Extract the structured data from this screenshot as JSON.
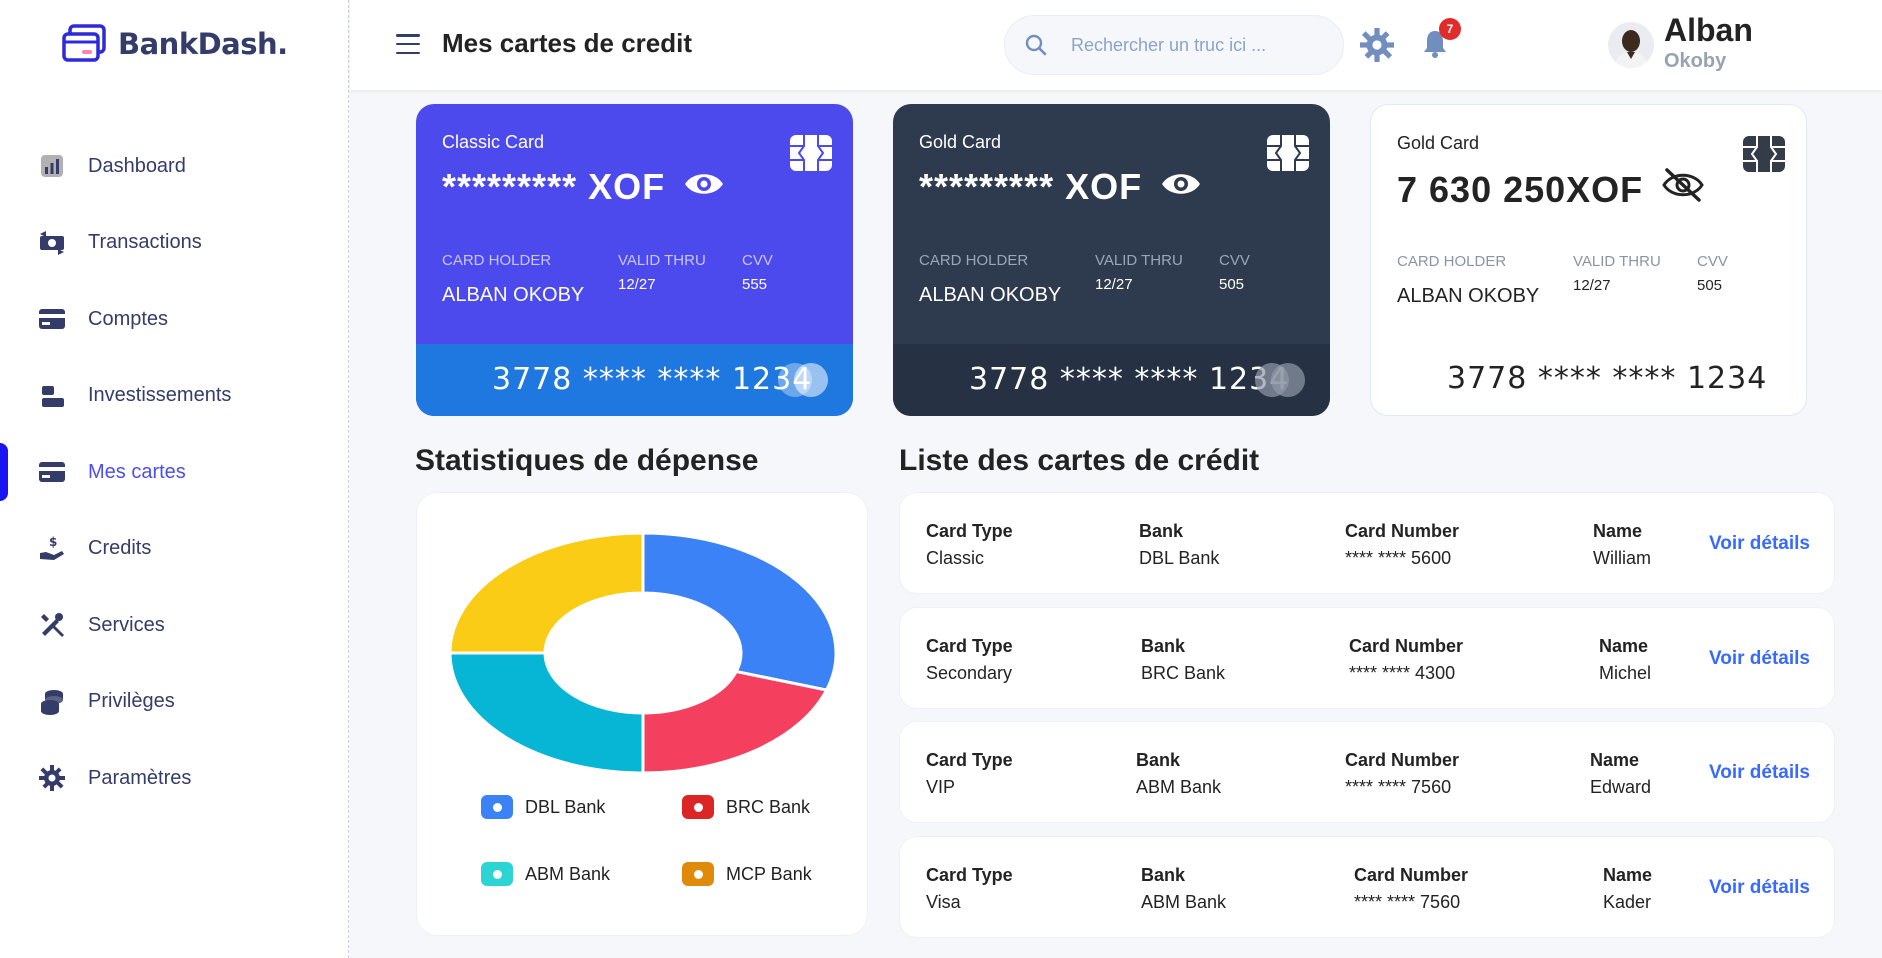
{
  "brand": {
    "name": "BankDash."
  },
  "header": {
    "title": "Mes cartes de credit",
    "search_placeholder": "Rechercher un truc ici ...",
    "notifications_count": "7",
    "user_first": "Alban",
    "user_last": "Okoby"
  },
  "sidebar": {
    "items": [
      {
        "label": "Dashboard",
        "icon": "dashboard-icon"
      },
      {
        "label": "Transactions",
        "icon": "transactions-icon"
      },
      {
        "label": "Comptes",
        "icon": "credit-card-icon"
      },
      {
        "label": "Investissements",
        "icon": "investments-icon"
      },
      {
        "label": "Mes cartes",
        "icon": "credit-card-icon",
        "active": true
      },
      {
        "label": "Credits",
        "icon": "loan-hand-icon"
      },
      {
        "label": "Services",
        "icon": "tools-icon"
      },
      {
        "label": "Privilèges",
        "icon": "coins-icon"
      },
      {
        "label": "Paramètres",
        "icon": "gear-icon"
      }
    ]
  },
  "cards": [
    {
      "type": "Classic Card",
      "amount": "********* XOF",
      "holder_label": "CARD HOLDER",
      "holder": "ALBAN OKOBY",
      "valid_label": "VALID THRU",
      "valid": "12/27",
      "cvv_label": "CVV",
      "cvv": "555",
      "number": "3778 **** **** 1234"
    },
    {
      "type": "Gold Card",
      "amount": "********* XOF",
      "holder_label": "CARD HOLDER",
      "holder": "ALBAN OKOBY",
      "valid_label": "VALID THRU",
      "valid": "12/27",
      "cvv_label": "CVV",
      "cvv": "505",
      "number": "3778 **** **** 1234"
    },
    {
      "type": "Gold Card",
      "amount": "7 630 250XOF",
      "holder_label": "CARD HOLDER",
      "holder": "ALBAN OKOBY",
      "valid_label": "VALID THRU",
      "valid": "12/27",
      "cvv_label": "CVV",
      "cvv": "505",
      "number": "3778 **** **** 1234"
    }
  ],
  "sections": {
    "stats_title": "Statistiques de dépense",
    "list_title": "Liste des cartes de crédit"
  },
  "chart_data": {
    "type": "pie",
    "title": "Statistiques de dépense",
    "categories": [
      "DBL Bank",
      "BRC Bank",
      "ABM Bank",
      "MCP Bank"
    ],
    "values": [
      30,
      20,
      25,
      25
    ],
    "colors": [
      "#3b82f6",
      "#f43f5e",
      "#06b6d4",
      "#facc15"
    ],
    "legend_colors": [
      "#3b82f6",
      "#dc2626",
      "#2dd4d4",
      "#e08a0b"
    ],
    "donut": true
  },
  "credit_list": {
    "headers": {
      "type": "Card Type",
      "bank": "Bank",
      "number": "Card Number",
      "name": "Name"
    },
    "link_label": "Voir détails",
    "rows": [
      {
        "type": "Classic",
        "bank": "DBL Bank",
        "number": "**** **** 5600",
        "name": "William"
      },
      {
        "type": "Secondary",
        "bank": "BRC Bank",
        "number": "**** **** 4300",
        "name": "Michel"
      },
      {
        "type": "VIP",
        "bank": "ABM Bank",
        "number": "**** **** 7560",
        "name": "Edward"
      },
      {
        "type": "Visa",
        "bank": "ABM Bank",
        "number": "**** **** 7560",
        "name": "Kader"
      }
    ]
  }
}
